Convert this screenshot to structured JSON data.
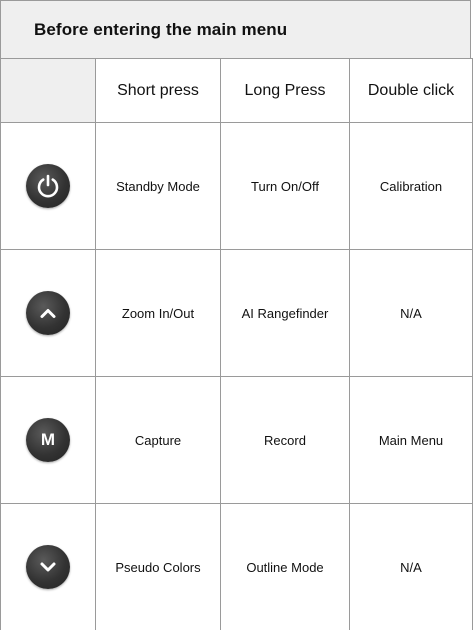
{
  "table_title": "Before entering the main menu",
  "columns": [
    "",
    "Short press",
    "Long Press",
    "Double click"
  ],
  "rows": [
    {
      "icon": "power-icon",
      "short": "Standby Mode",
      "long": "Turn On/Off",
      "double": "Calibration"
    },
    {
      "icon": "chevron-up-icon",
      "short": "Zoom In/Out",
      "long": "AI Rangefinder",
      "double": "N/A"
    },
    {
      "icon": "m-button-icon",
      "icon_letter": "M",
      "short": "Capture",
      "long": "Record",
      "double": "Main Menu"
    },
    {
      "icon": "chevron-down-icon",
      "short": "Pseudo Colors",
      "long": "Outline Mode",
      "double": "N/A"
    }
  ],
  "colors": {
    "header_bg": "#efefef",
    "border": "#9a9a9a",
    "button": "#333333"
  }
}
